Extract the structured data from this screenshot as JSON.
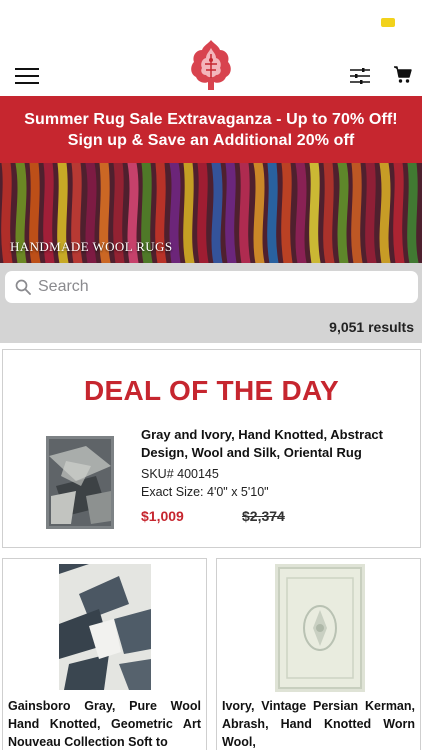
{
  "colors": {
    "brand_red": "#c6262f",
    "search_bg": "#d4d4d4"
  },
  "header": {
    "menu_icon": "hamburger-icon",
    "logo": "ornamental-leaf-logo",
    "filter_icon": "sliders-icon",
    "cart_icon": "cart-icon"
  },
  "promo": {
    "line1": "Summer Rug Sale Extravaganza - Up to 70% Off!",
    "line2": "Sign up & Save an Additional 20% off"
  },
  "hero": {
    "label": "HANDMADE WOOL RUGS"
  },
  "search": {
    "placeholder": "Search"
  },
  "results": {
    "count": "9,051 results"
  },
  "deal": {
    "heading": "DEAL OF THE DAY",
    "name": "Gray and Ivory, Hand Knotted, Abstract Design, Wool and Silk, Oriental Rug",
    "sku": "SKU# 400145",
    "size": "Exact Size: 4'0\" x 5'10\"",
    "price": "$1,009",
    "original_price": "$2,374"
  },
  "products": [
    {
      "name": "Gainsboro Gray, Pure Wool Hand Knotted, Geometric Art Nouveau Collection Soft to"
    },
    {
      "name": "Ivory, Vintage Persian Kerman, Abrash, Hand Knotted Worn Wool,"
    }
  ]
}
